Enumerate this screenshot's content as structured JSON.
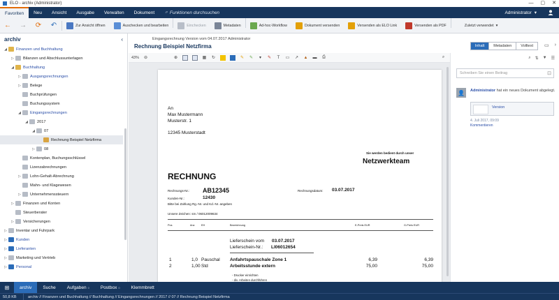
{
  "window": {
    "title": "ELO - archiv (Administrator)",
    "controls": [
      "—",
      "▢",
      "✕"
    ]
  },
  "menu": {
    "tabs": [
      "Favoriten",
      "Neu",
      "Ansicht",
      "Ausgabe",
      "Verwalten",
      "Dokument"
    ],
    "search": "Funktionen durchsuchen",
    "user": "Administrator"
  },
  "ribbon": {
    "items": [
      {
        "label": "Zur Ansicht öffnen",
        "color": "#4a78c2"
      },
      {
        "label": "Auschecken und bearbeiten",
        "color": "#5a8ed6"
      },
      {
        "label": "Einchecken",
        "color": "#b8bec8"
      },
      {
        "label": "Metadaten",
        "color": "#7a8597"
      },
      {
        "label": "Ad-hoc-Workflow",
        "color": "#6aa84f"
      },
      {
        "label": "Dokument versenden",
        "color": "#e3a008"
      },
      {
        "label": "Versenden als ELO Link",
        "color": "#e3a008"
      },
      {
        "label": "Versenden als PDF",
        "color": "#c0392b"
      },
      {
        "label": "Zuletzt verwendet",
        "color": "#f1f3f6"
      }
    ]
  },
  "left": {
    "title": "archiv",
    "tree": [
      {
        "label": "Finanzen und Buchhaltung",
        "level": 0,
        "exp": "◢",
        "link": true,
        "color": "#e0b44a"
      },
      {
        "label": "Bilanzen und Abschlussunterlagen",
        "level": 1,
        "exp": "▷",
        "link": false,
        "color": "#b6bcc6"
      },
      {
        "label": "Buchhaltung",
        "level": 1,
        "exp": "◢",
        "link": true,
        "color": "#e0b44a"
      },
      {
        "label": "Ausgangsrechnungen",
        "level": 2,
        "exp": "▷",
        "link": true,
        "color": "#b6bcc6"
      },
      {
        "label": "Belege",
        "level": 2,
        "exp": "▷",
        "link": false,
        "color": "#b6bcc6"
      },
      {
        "label": "Buchprüfungen",
        "level": 2,
        "exp": "",
        "link": false,
        "color": "#b6bcc6"
      },
      {
        "label": "Buchungssystem",
        "level": 2,
        "exp": "",
        "link": false,
        "color": "#b6bcc6"
      },
      {
        "label": "Eingangsrechnungen",
        "level": 2,
        "exp": "◢",
        "link": true,
        "color": "#b6bcc6"
      },
      {
        "label": "2017",
        "level": 3,
        "exp": "◢",
        "link": false,
        "color": "#b6bcc6"
      },
      {
        "label": "07",
        "level": 4,
        "exp": "◢",
        "link": false,
        "color": "#b6bcc6"
      },
      {
        "label": "Rechnung Beispiel Netzfirma",
        "level": 5,
        "exp": "",
        "link": false,
        "color": "#d9a441",
        "selected": true
      },
      {
        "label": "08",
        "level": 4,
        "exp": "▷",
        "link": false,
        "color": "#b6bcc6"
      },
      {
        "label": "Kontenplan, Buchungsschlüssel",
        "level": 2,
        "exp": "",
        "link": false,
        "color": "#b6bcc6"
      },
      {
        "label": "Lizenzabrechnungen",
        "level": 2,
        "exp": "",
        "link": false,
        "color": "#b6bcc6"
      },
      {
        "label": "Lohn-Gehalt-Abrechnung",
        "level": 2,
        "exp": "▷",
        "link": false,
        "color": "#b6bcc6"
      },
      {
        "label": "Mahn- und Klagewesen",
        "level": 2,
        "exp": "",
        "link": false,
        "color": "#b6bcc6"
      },
      {
        "label": "Unternehmenssteuern",
        "level": 2,
        "exp": "▷",
        "link": false,
        "color": "#b6bcc6"
      },
      {
        "label": "Finanzen und Konten",
        "level": 1,
        "exp": "▷",
        "link": false,
        "color": "#b6bcc6"
      },
      {
        "label": "Steuerberater",
        "level": 1,
        "exp": "",
        "link": false,
        "color": "#b6bcc6"
      },
      {
        "label": "Versicherungen",
        "level": 1,
        "exp": "▷",
        "link": false,
        "color": "#b6bcc6"
      },
      {
        "label": "Inventar und Fuhrpark",
        "level": 0,
        "exp": "▷",
        "link": false,
        "color": "#b6bcc6"
      },
      {
        "label": "Kunden",
        "level": 0,
        "exp": "▷",
        "link": true,
        "color": "#2b6cb8"
      },
      {
        "label": "Lieferanten",
        "level": 0,
        "exp": "▷",
        "link": true,
        "color": "#2b6cb8"
      },
      {
        "label": "Marketing und Vertrieb",
        "level": 0,
        "exp": "▷",
        "link": false,
        "color": "#b6bcc6"
      },
      {
        "label": "Personal",
        "level": 0,
        "exp": "▷",
        "link": true,
        "color": "#2b6cb8"
      }
    ]
  },
  "doc": {
    "meta": "Eingangsrechnung  Version vom 04.07.2017  Administrator",
    "title": "Rechnung Beispiel Netzfirma",
    "tabs": [
      "Inhalt",
      "Metadaten",
      "Volltext"
    ]
  },
  "viewer": {
    "zoom": "43%",
    "page": {
      "to": "An",
      "name": "Max Mustermann",
      "street": "Musterstr. 1",
      "city": "12345 Musterstadt",
      "slogan": "Sie werden bedient durch unser",
      "brand": "Netzwerkteam",
      "heading": "RECHNUNG",
      "invoice_no_label": "Rechnungs-Nr.:",
      "invoice_no": "AB12345",
      "date_label": "Rechnungsdatum:",
      "date": "03.07.2017",
      "customer_label": "Kunden-Nr.:",
      "customer_no": "12430",
      "note": "Bitte bei Zahlung Rg.-Nr. und Kd.-Nr. angeben",
      "ref": "Unsere Zeichen: sm / 06012009634",
      "col_pos": "Pos",
      "col_qty": "Anz",
      "col_unit": "EH",
      "col_desc": "Bezeichnung",
      "col_eprice": "E-Preis EUR",
      "col_gprice": "G-Preis EUR",
      "delivery1": "Lieferschein vom",
      "delivery1_date": "03.07.2017",
      "delivery2": "Lieferschein-Nr.:",
      "delivery2_no": "LI06012654",
      "rows": [
        {
          "pos": "1",
          "qty": "1,0",
          "unit": "Pauschal",
          "desc": "Anfahrtspauschale Zone 1",
          "e": "6,39",
          "g": "6,39"
        },
        {
          "pos": "2",
          "qty": "1,00",
          "unit": "Std",
          "desc": "Arbeitsstunde extern",
          "e": "75,00",
          "g": "75,00"
        }
      ],
      "sub1": "- Drucker einrichten",
      "sub2": "- div. Arbeiten durchführen"
    }
  },
  "right": {
    "placeholder": "Schreiben Sie einen Beitrag",
    "user": "Administrator",
    "action": "hat ein neues Dokument abgelegt.",
    "card_label": "Version",
    "date": "4. Juli 2017, 09:09",
    "link": "Kommentieren"
  },
  "bottom": {
    "tabs": [
      {
        "label": "archiv",
        "count": ""
      },
      {
        "label": "Suche",
        "count": ""
      },
      {
        "label": "Aufgaben",
        "count": "0"
      },
      {
        "label": "Postbox",
        "count": "0"
      },
      {
        "label": "Klemmbrett",
        "count": ""
      }
    ]
  },
  "status": {
    "size": "50,8 KB",
    "path": "archiv // Finanzen und Buchhaltung // Buchhaltung // Eingangsrechnungen // 2017 // 07 // Rechnung Beispiel Netzfirma"
  }
}
